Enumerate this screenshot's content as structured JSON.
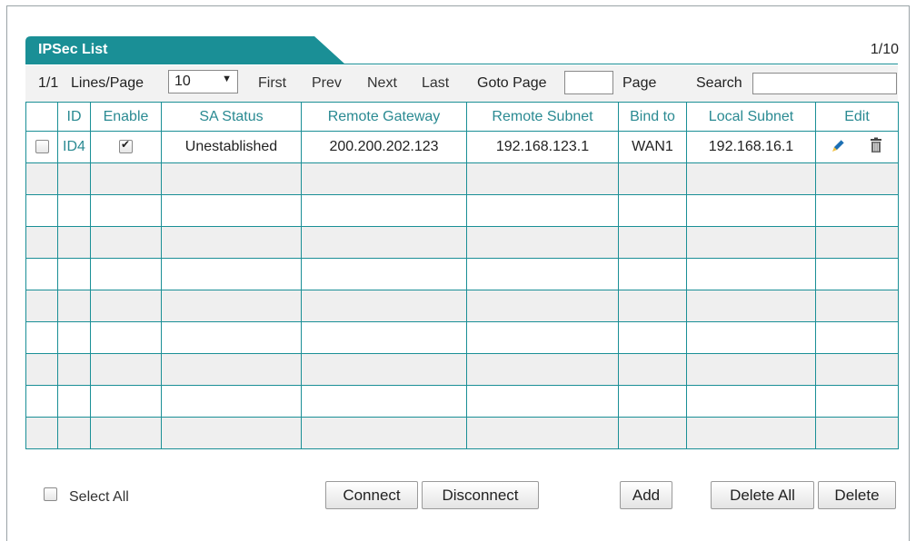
{
  "panel": {
    "title": "IPSec List",
    "page_count": "1/10"
  },
  "toolbar": {
    "current_page": "1/1",
    "lines_per_page_label": "Lines/Page",
    "lines_per_page_value": "10",
    "first": "First",
    "prev": "Prev",
    "next": "Next",
    "last": "Last",
    "goto_label": "Goto Page",
    "goto_value": "",
    "page_label": "Page",
    "search_label": "Search",
    "search_value": ""
  },
  "table": {
    "headers": {
      "id": "ID",
      "enable": "Enable",
      "sa_status": "SA Status",
      "remote_gateway": "Remote Gateway",
      "remote_subnet": "Remote Subnet",
      "bind_to": "Bind to",
      "local_subnet": "Local Subnet",
      "edit": "Edit"
    },
    "rows": [
      {
        "selected": false,
        "id": "ID4",
        "enabled": true,
        "sa_status": "Unestablished",
        "remote_gateway": "200.200.202.123",
        "remote_subnet": "192.168.123.1",
        "bind_to": "WAN1",
        "local_subnet": "192.168.16.1"
      }
    ]
  },
  "footer": {
    "select_all": "Select All",
    "connect": "Connect",
    "disconnect": "Disconnect",
    "add": "Add",
    "delete_all": "Delete All",
    "delete": "Delete"
  },
  "colors": {
    "accent": "#1a8f96",
    "header_text": "#2a8a92",
    "alt_row": "#efefef"
  },
  "icons": {
    "edit": "pencil-icon",
    "delete": "trash-icon"
  }
}
